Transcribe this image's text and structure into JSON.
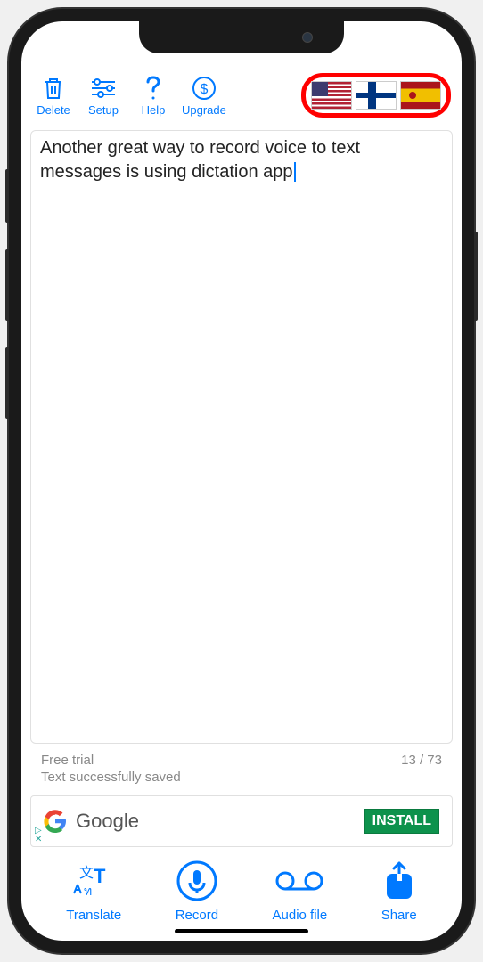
{
  "toolbar": {
    "delete_label": "Delete",
    "setup_label": "Setup",
    "help_label": "Help",
    "upgrade_label": "Upgrade"
  },
  "flags": {
    "flag1": "us",
    "flag2": "fi",
    "flag3": "es"
  },
  "text_content": "Another great way to record voice to text messages is using dictation app",
  "status": {
    "trial_text": "Free trial",
    "char_count": "13 / 73",
    "saved_text": "Text successfully saved"
  },
  "ad": {
    "title": "Google",
    "cta": "INSTALL",
    "marker_top": "▷",
    "marker_bottom": "✕"
  },
  "bottom": {
    "translate_label": "Translate",
    "record_label": "Record",
    "audio_label": "Audio file",
    "share_label": "Share"
  }
}
